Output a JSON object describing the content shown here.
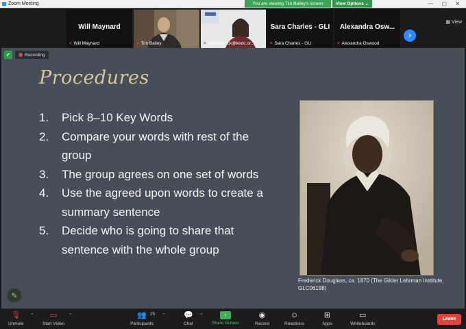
{
  "window": {
    "title": "Zoom Meeting",
    "controls": "—  ▢  ✕"
  },
  "share_banner": {
    "viewing_text": "You are viewing Tim Bailey's screen",
    "view_options_label": "View Options ⌄"
  },
  "view_button": "▦ View",
  "participants_strip": [
    {
      "big_name": "Will Maynard",
      "small_name": "Will Maynard"
    },
    {
      "big_name": "",
      "small_name": "Tim Bailey"
    },
    {
      "big_name": "",
      "small_name": "kajmhedrick@kedc.or..."
    },
    {
      "big_name": "Sara Charles - GLI",
      "small_name": "Sara Charles - GLI"
    },
    {
      "big_name": "Alexandra Osw...",
      "small_name": "Alexandra Oswood"
    }
  ],
  "recording_label": "Recording",
  "slide": {
    "title": "Procedures",
    "items": [
      {
        "num": "1.",
        "text": "Pick 8–10 Key Words"
      },
      {
        "num": "2.",
        "text": "Compare your words with rest of the group"
      },
      {
        "num": "3.",
        "text": "The group agrees on one set of words"
      },
      {
        "num": "4.",
        "text": "Use the agreed upon words to create a summary sentence"
      },
      {
        "num": "5.",
        "text": "Decide who is going to share that sentence with the whole group"
      }
    ],
    "caption": "Frederick Douglass, ca. 1870 (The Gilder Lehrman Institute, GLC06198)"
  },
  "toolbar": {
    "unmute": "Unmute",
    "start_video": "Start Video",
    "participants": "Participants",
    "participants_count": "25",
    "chat": "Chat",
    "share_screen": "Share Screen",
    "record": "Record",
    "reactions": "Reactions",
    "apps": "Apps",
    "whiteboards": "Whiteboards",
    "leave": "Leave"
  },
  "colors": {
    "accent_blue": "#2d8cff",
    "share_green": "#3fa05a",
    "leave_red": "#e0453a",
    "slide_bg": "#464e5a",
    "title_gold": "#d8c79a"
  }
}
